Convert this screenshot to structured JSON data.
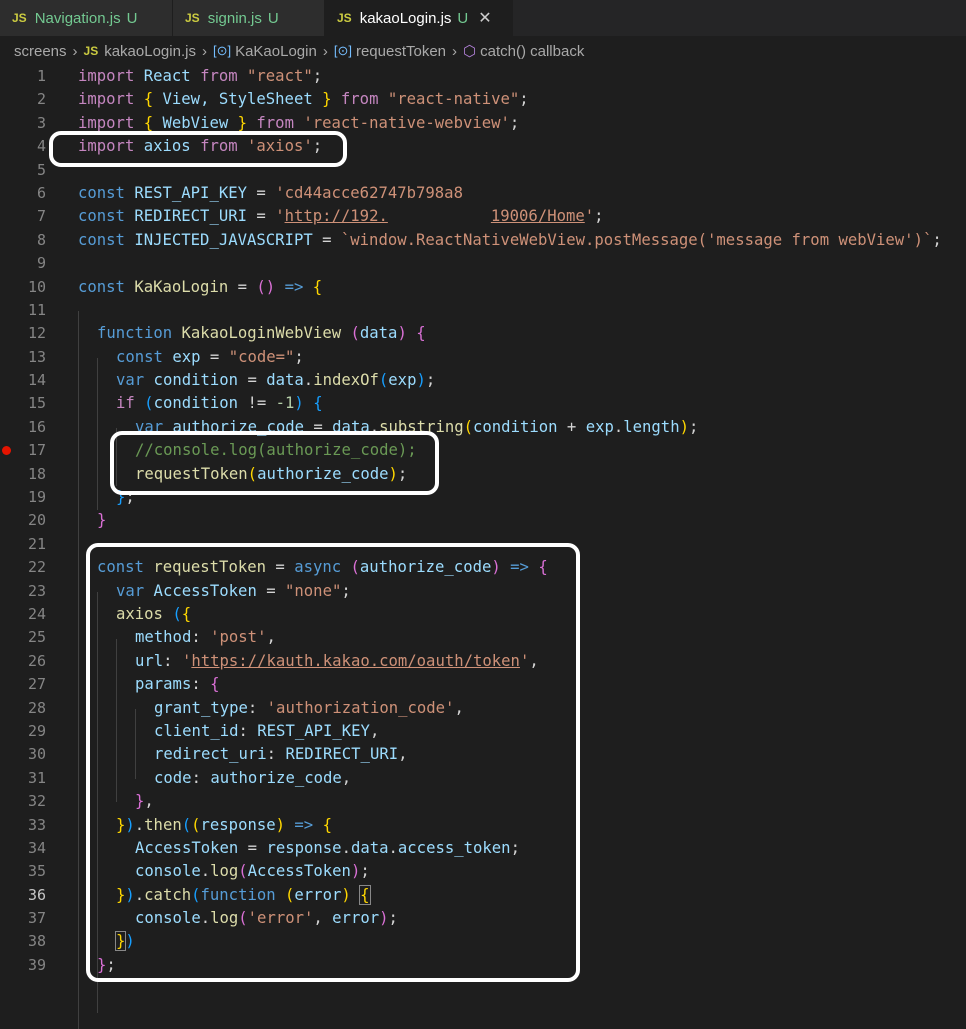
{
  "tabs": [
    {
      "badge": "JS",
      "name": "Navigation.js",
      "status": "U",
      "active": false
    },
    {
      "badge": "JS",
      "name": "signin.js",
      "status": "U",
      "active": false
    },
    {
      "badge": "JS",
      "name": "kakaoLogin.js",
      "status": "U",
      "active": true,
      "close": "✕"
    }
  ],
  "breadcrumb": [
    "screens",
    "kakaoLogin.js",
    "KaKaoLogin",
    "requestToken",
    "catch() callback"
  ],
  "breadcrumb_js_badge": "JS",
  "line_numbers": [
    "1",
    "2",
    "3",
    "4",
    "5",
    "6",
    "7",
    "8",
    "9",
    "10",
    "11",
    "12",
    "13",
    "14",
    "15",
    "16",
    "17",
    "18",
    "19",
    "20",
    "21",
    "22",
    "23",
    "24",
    "25",
    "26",
    "27",
    "28",
    "29",
    "30",
    "31",
    "32",
    "33",
    "34",
    "35",
    "36",
    "37",
    "38",
    "39"
  ],
  "current_line": "36",
  "breakpoint_line": "17",
  "colors": {
    "accent": "#0e639c",
    "breakpoint": "#e51400",
    "keyword": "#569cd6",
    "import": "#c586c0",
    "string": "#ce9178",
    "variable": "#9cdcfe",
    "function": "#dcdcaa",
    "comment": "#6a9955"
  },
  "code": {
    "l1": {
      "a": "import",
      "b": " React ",
      "c": "from",
      "d": " \"react\"",
      "e": ";"
    },
    "l2": {
      "a": "import",
      "b": " ",
      "c": "{",
      "d": " View, StyleSheet ",
      "e": "}",
      "f": " from",
      "g": " \"react-native\"",
      "h": ";"
    },
    "l3": {
      "a": "import",
      "b": " ",
      "c": "{",
      "d": " WebView ",
      "e": "}",
      "f": " from",
      "g": " 'react-native-webview'",
      "h": ";"
    },
    "l4": {
      "a": "import",
      "b": " axios ",
      "c": "from",
      "d": " 'axios'",
      "e": ";"
    },
    "l6": {
      "a": "const",
      "b": " REST_API_KEY",
      "c": " = ",
      "d": "'cd44acce62747b798a8"
    },
    "l7": {
      "a": "const",
      "b": " REDIRECT_URI",
      "c": " = ",
      "d": "'",
      "e": "http://192.",
      "f": "19006/Home",
      "g": "'",
      "h": ";"
    },
    "l8": {
      "a": "const",
      "b": " INJECTED_JAVASCRIPT",
      "c": " = ",
      "d": "`window.ReactNativeWebView.postMessage('message from webView')`",
      "e": ";"
    },
    "l10": {
      "a": "const",
      "b": " KaKaoLogin",
      "c": " = ",
      "d": "()",
      "e": " => ",
      "f": "{"
    },
    "l12": {
      "a": "function",
      "b": " KakaoLoginWebView ",
      "c": "(",
      "d": "data",
      "e": ")",
      "f": " ",
      "g": "{"
    },
    "l13": {
      "a": "const",
      "b": " exp",
      "c": " = ",
      "d": "\"code=\"",
      "e": ";"
    },
    "l14": {
      "a": "var",
      "b": " condition",
      "c": " = ",
      "d": "data",
      "e": ".",
      "f": "indexOf",
      "g": "(",
      "h": "exp",
      "i": ")",
      "j": ";"
    },
    "l15": {
      "a": "if",
      "b": " ",
      "c": "(",
      "d": "condition",
      "e": " != ",
      "f": "-1",
      "g": ")",
      "h": " ",
      "i": "{"
    },
    "l16": {
      "a": "var",
      "b": " authorize_code",
      "c": " = ",
      "d": "data",
      "e": ".",
      "f": "substring",
      "g": "(",
      "h": "condition",
      "i": " + ",
      "j": "exp",
      "k": ".",
      "l": "length",
      "m": ")",
      "n": ";"
    },
    "l17": {
      "a": "//console.log(authorize_code);"
    },
    "l18": {
      "a": "requestToken",
      "b": "(",
      "c": "authorize_code",
      "d": ")",
      "e": ";"
    },
    "l19": {
      "a": "}",
      "b": ";"
    },
    "l20": {
      "a": "}"
    },
    "l22": {
      "a": "const",
      "b": " requestToken",
      "c": " = ",
      "d": "async",
      "e": " ",
      "f": "(",
      "g": "authorize_code",
      "h": ")",
      "i": " => ",
      "j": "{"
    },
    "l23": {
      "a": "var",
      "b": " AccessToken",
      "c": " = ",
      "d": "\"none\"",
      "e": ";"
    },
    "l24": {
      "a": "axios",
      "b": " ",
      "c": "(",
      "d": "{"
    },
    "l25": {
      "a": "method",
      "b": ": ",
      "c": "'post'",
      "d": ","
    },
    "l26": {
      "a": "url",
      "b": ": ",
      "c": "'",
      "d": "https://kauth.kakao.com/oauth/token",
      "e": "'",
      "f": ","
    },
    "l27": {
      "a": "params",
      "b": ": ",
      "c": "{"
    },
    "l28": {
      "a": "grant_type",
      "b": ": ",
      "c": "'authorization_code'",
      "d": ","
    },
    "l29": {
      "a": "client_id",
      "b": ": ",
      "c": "REST_API_KEY",
      "d": ","
    },
    "l30": {
      "a": "redirect_uri",
      "b": ": ",
      "c": "REDIRECT_URI",
      "d": ","
    },
    "l31": {
      "a": "code",
      "b": ": ",
      "c": "authorize_code",
      "d": ","
    },
    "l32": {
      "a": "}",
      "b": ","
    },
    "l33": {
      "a": "}",
      "b": ")",
      "c": ".",
      "d": "then",
      "e": "(",
      "f": "(",
      "g": "response",
      "h": ")",
      "i": " => ",
      "j": "{"
    },
    "l34": {
      "a": "AccessToken",
      "b": " = ",
      "c": "response",
      "d": ".",
      "e": "data",
      "f": ".",
      "g": "access_token",
      "h": ";"
    },
    "l35": {
      "a": "console",
      "b": ".",
      "c": "log",
      "d": "(",
      "e": "AccessToken",
      "f": ")",
      "g": ";"
    },
    "l36": {
      "a": "}",
      "b": ")",
      "c": ".",
      "d": "catch",
      "e": "(",
      "f": "function",
      "g": " ",
      "h": "(",
      "i": "error",
      "j": ")",
      "k": " ",
      "l": "{"
    },
    "l37": {
      "a": "console",
      "b": ".",
      "c": "log",
      "d": "(",
      "e": "'error'",
      "f": ", ",
      "g": "error",
      "h": ")",
      "i": ";"
    },
    "l38": {
      "a": "}",
      "b": ")"
    },
    "l39": {
      "a": "}",
      "b": ";"
    }
  }
}
